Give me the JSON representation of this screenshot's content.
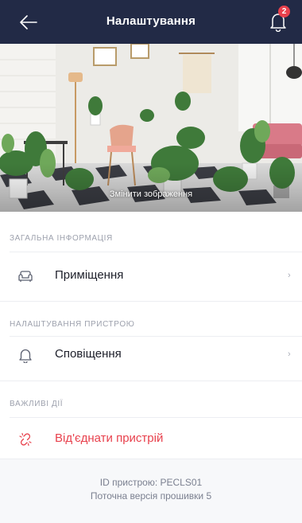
{
  "header": {
    "title": "Налаштування",
    "notification_count": "2"
  },
  "hero": {
    "change_image_label": "Змінити зображення"
  },
  "sections": {
    "general": {
      "label": "ЗАГАЛЬНА ІНФОРМАЦІЯ",
      "item_label": "Приміщення",
      "item_icon": "sofa-icon"
    },
    "device_settings": {
      "label": "НАЛАШТУВАННЯ ПРИСТРОЮ",
      "item_label": "Сповіщення",
      "item_icon": "bell-icon"
    },
    "important": {
      "label": "ВАЖЛИВІ ДІЇ",
      "item_label": "Від'єднати пристрій",
      "item_icon": "unlink-icon"
    }
  },
  "footer": {
    "device_id": "ID пристрою: PECLS01",
    "firmware": "Поточна версія прошивки 5"
  },
  "colors": {
    "header_bg": "#222a46",
    "danger": "#e8414d",
    "muted": "#9da1ad"
  }
}
